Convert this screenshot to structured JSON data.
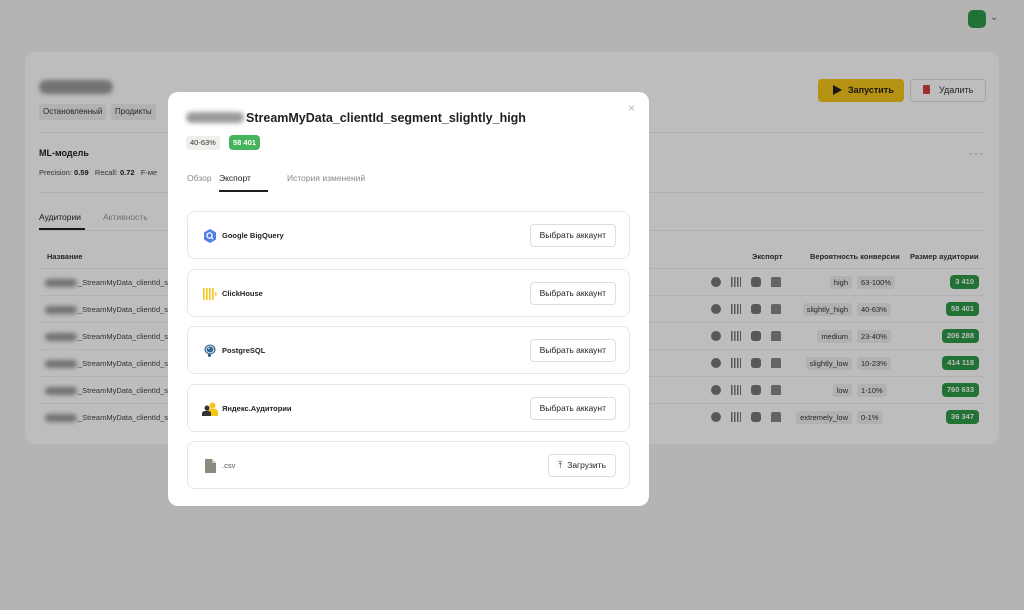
{
  "background": {
    "tags": [
      "Остановленный",
      "Продикты"
    ],
    "run_label": "Запустить",
    "delete_label": "Удалить",
    "ml": {
      "title": "ML-модель",
      "precision_label": "Precision:",
      "precision_value": "0.59",
      "recall_label": "Recall:",
      "recall_value": "0.72",
      "f_label": "F-ме"
    },
    "tabs": [
      "Аудитории",
      "Активность"
    ],
    "columns": {
      "name": "Название",
      "export": "Экспорт",
      "probability": "Вероятность конверсии",
      "size": "Размер аудитории"
    },
    "rows": [
      {
        "name": "_StreamMyData_clientId_se",
        "segment": "high",
        "range": "63-100%",
        "size": "3 410"
      },
      {
        "name": "_StreamMyData_clientId_se",
        "segment": "slightly_high",
        "range": "40-63%",
        "size": "58 401"
      },
      {
        "name": "_StreamMyData_clientId_se",
        "segment": "medium",
        "range": "23-40%",
        "size": "206 288"
      },
      {
        "name": "_StreamMyData_clientId_se",
        "segment": "slightly_low",
        "range": "10-23%",
        "size": "414 118"
      },
      {
        "name": "_StreamMyData_clientId_se",
        "segment": "low",
        "range": "1-10%",
        "size": "760 633"
      },
      {
        "name": "_StreamMyData_clientId_se",
        "segment": "extremely_low",
        "range": "0-1%",
        "size": "36 347"
      }
    ]
  },
  "modal": {
    "close_glyph": "×",
    "title": "StreamMyData_clientId_segment_slightly_high",
    "percent": "40-63%",
    "count": "58 401",
    "tabs": [
      "Обзор",
      "Экспорт",
      "История изменений"
    ],
    "destinations": [
      {
        "name": "Google BigQuery",
        "action": "Выбрать аккаунт",
        "icon": "bigquery-icon"
      },
      {
        "name": "ClickHouse",
        "action": "Выбрать аккаунт",
        "icon": "clickhouse-icon"
      },
      {
        "name": "PostgreSQL",
        "action": "Выбрать аккаунт",
        "icon": "postgresql-icon"
      },
      {
        "name": "Яндекс.Аудитории",
        "action": "Выбрать аккаунт",
        "icon": "yandex-audiences-icon"
      },
      {
        "name": ".csv",
        "action": "Загрузить",
        "icon": "csv-file-icon"
      }
    ]
  },
  "colors": {
    "accent_yellow": "#f5c518",
    "badge_green": "#45b45d",
    "size_green": "#2f9a4a",
    "danger_red": "#d8403a"
  }
}
